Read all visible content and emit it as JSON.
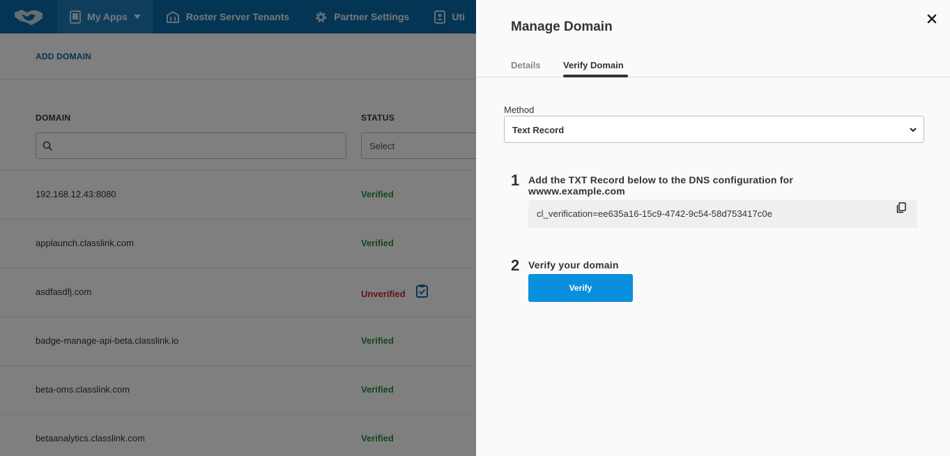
{
  "nav": {
    "items": [
      {
        "label": "My Apps",
        "icon": "tablet-icon"
      },
      {
        "label": "Roster Server Tenants",
        "icon": "building-icon"
      },
      {
        "label": "Partner Settings",
        "icon": "gear-icon"
      },
      {
        "label": "Uti",
        "icon": "contact-card-icon"
      }
    ]
  },
  "toolbar": {
    "add_domain": "ADD DOMAIN"
  },
  "table": {
    "headers": {
      "domain": "DOMAIN",
      "status": "STATUS"
    },
    "status_filter_placeholder": "Select",
    "rows": [
      {
        "domain": "192.168.12.43:8080",
        "status": "Verified"
      },
      {
        "domain": "applaunch.classlink.com",
        "status": "Verified"
      },
      {
        "domain": "asdfasdfj.com",
        "status": "Unverified"
      },
      {
        "domain": "badge-manage-api-beta.classlink.io",
        "status": "Verified"
      },
      {
        "domain": "beta-oms.classlink.com",
        "status": "Verified"
      },
      {
        "domain": "betaanalytics.classlink.com",
        "status": "Verified"
      }
    ]
  },
  "panel": {
    "title": "Manage Domain",
    "tabs": [
      "Details",
      "Verify Domain"
    ],
    "active_tab": "Verify Domain",
    "method_label": "Method",
    "method_value": "Text Record",
    "step1": {
      "number": "1",
      "title": "Add the TXT Record below to the DNS configuration for wwww.example.com",
      "record": "cl_verification=ee635a16-15c9-4742-9c54-58d753417c0e"
    },
    "step2": {
      "number": "2",
      "title": "Verify your domain",
      "button": "Verify"
    }
  },
  "colors": {
    "nav_bg": "#0a6aa8",
    "verified": "#2e8b3a",
    "unverified": "#c62828",
    "primary_button": "#0a8fdc"
  }
}
